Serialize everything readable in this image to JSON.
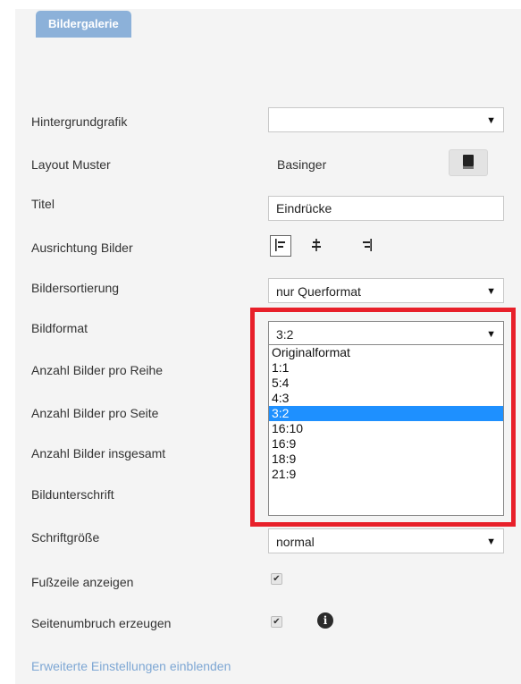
{
  "panel": {
    "tab_label": "Bildergalerie"
  },
  "fields": {
    "hintergrund": {
      "label": "Hintergrundgrafik",
      "value": ""
    },
    "layout": {
      "label": "Layout Muster",
      "value": "Basinger",
      "button_icon": "book-icon"
    },
    "titel": {
      "label": "Titel",
      "value": "Eindrücke"
    },
    "ausrichtung": {
      "label": "Ausrichtung Bilder",
      "options": [
        "align-left-icon",
        "align-center-icon",
        "align-right-icon"
      ],
      "selected": "align-left-icon"
    },
    "sortierung": {
      "label": "Bildersortierung",
      "value": "nur Querformat"
    },
    "bildformat": {
      "label": "Bildformat",
      "value": "3:2",
      "options": [
        "Originalformat",
        "1:1",
        "5:4",
        "4:3",
        "3:2",
        "16:10",
        "16:9",
        "18:9",
        "21:9"
      ],
      "selected_index": 4
    },
    "pro_reihe": {
      "label": "Anzahl Bilder pro Reihe"
    },
    "pro_seite": {
      "label": "Anzahl Bilder pro Seite"
    },
    "insgesamt": {
      "label": "Anzahl Bilder insgesamt"
    },
    "unterschrift": {
      "label": "Bildunterschrift"
    },
    "schriftgroesse": {
      "label": "Schriftgröße",
      "value": "normal"
    },
    "fusszeile": {
      "label": "Fußzeile anzeigen",
      "checked": true
    },
    "seitenumbruch": {
      "label": "Seitenumbruch erzeugen",
      "checked": true,
      "info_icon": "info-icon"
    }
  },
  "links": {
    "advanced": "Erweiterte Einstellungen einblenden"
  },
  "colors": {
    "tab": "#8cb1d9",
    "highlight": "#e8202a",
    "selected_option": "#1e90ff",
    "link": "#7ea7d4"
  }
}
